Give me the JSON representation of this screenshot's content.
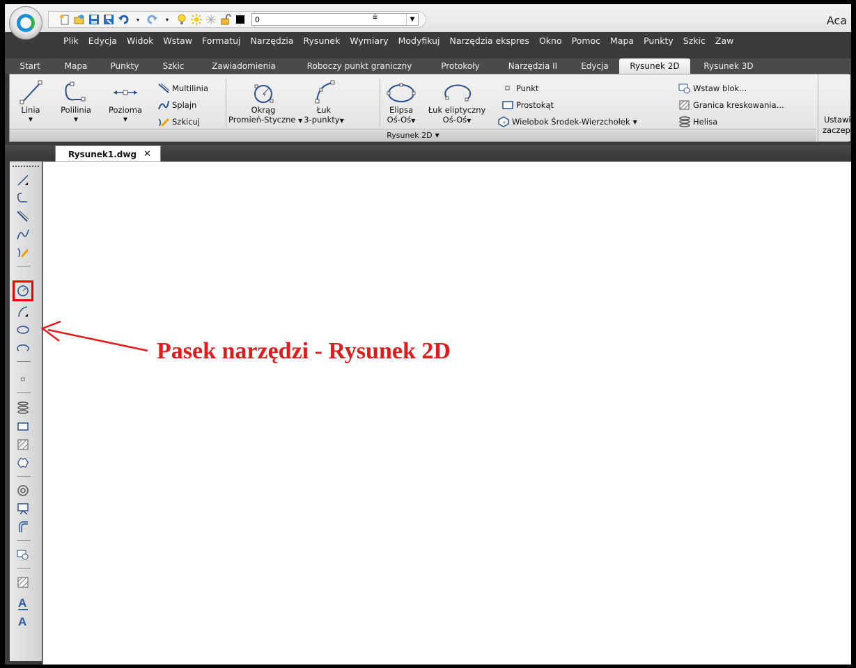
{
  "app": {
    "title_fragment": "Aca",
    "layer_value": "0",
    "colors": {
      "menubar": "#3b3b3b",
      "accent": "#1a8fd6",
      "annotation": "#e11b1b"
    }
  },
  "menubar": {
    "items": [
      "Plik",
      "Edycja",
      "Widok",
      "Wstaw",
      "Formatuj",
      "Narzędzia",
      "Rysunek",
      "Wymiary",
      "Modyfikuj",
      "Narzędzia ekspres",
      "Okno",
      "Pomoc",
      "Mapa",
      "Punkty",
      "Szkic",
      "Zaw"
    ]
  },
  "ribbon_tabs": {
    "items": [
      "Start",
      "Mapa",
      "Punkty",
      "Szkic",
      "Zawiadomienia",
      "Roboczy punkt graniczny",
      "Protokoły",
      "Narzędzia II",
      "Edycja",
      "Rysunek 2D",
      "Rysunek 3D"
    ],
    "active": "Rysunek 2D"
  },
  "ribbon": {
    "linia": "Linia",
    "polilinia": "Polilinia",
    "pozioma": "Pozioma",
    "multilinia": "Multilinia",
    "splajn": "Splajn",
    "szkicuj": "Szkicuj",
    "okrag_1": "Okrąg",
    "okrag_2": "Promień-Styczne",
    "luk_1": "Łuk",
    "luk_2": "3-punkty",
    "elipsa_1": "Elipsa",
    "elipsa_2": "Oś-Oś",
    "luk_elipt_1": "Łuk eliptyczny",
    "luk_elipt_2": "Oś-Oś",
    "punkt": "Punkt",
    "prostokat": "Prostokąt",
    "wielobok": "Wielobok Środek-Wierzchołek",
    "wstaw_blok": "Wstaw blok...",
    "granica": "Granica kreskowania...",
    "helisa": "Helisa",
    "ustawi_1": "Ustawi",
    "ustawi_2": "zaczepi",
    "panel_title": "Rysunek 2D"
  },
  "document": {
    "tab_label": "Rysunek1.dwg",
    "close_glyph": "✕"
  },
  "left_toolbar": {
    "icons": [
      "line-icon",
      "polyline-icon",
      "multiline-icon",
      "spline-icon",
      "sketch-icon",
      "circle-icon",
      "arc-icon",
      "ellipse-icon",
      "elliptical-arc-icon",
      "point-icon",
      "helix-icon",
      "rectangle-icon",
      "hatch-icon",
      "revision-cloud-icon",
      "donut-icon",
      "wipeout-icon",
      "fillet-polyline-icon",
      "insert-block-icon",
      "hatch-boundary-icon",
      "text-icon",
      "mtext-icon"
    ]
  },
  "annotation": {
    "text": "Pasek narzędzi - Rysunek 2D"
  }
}
